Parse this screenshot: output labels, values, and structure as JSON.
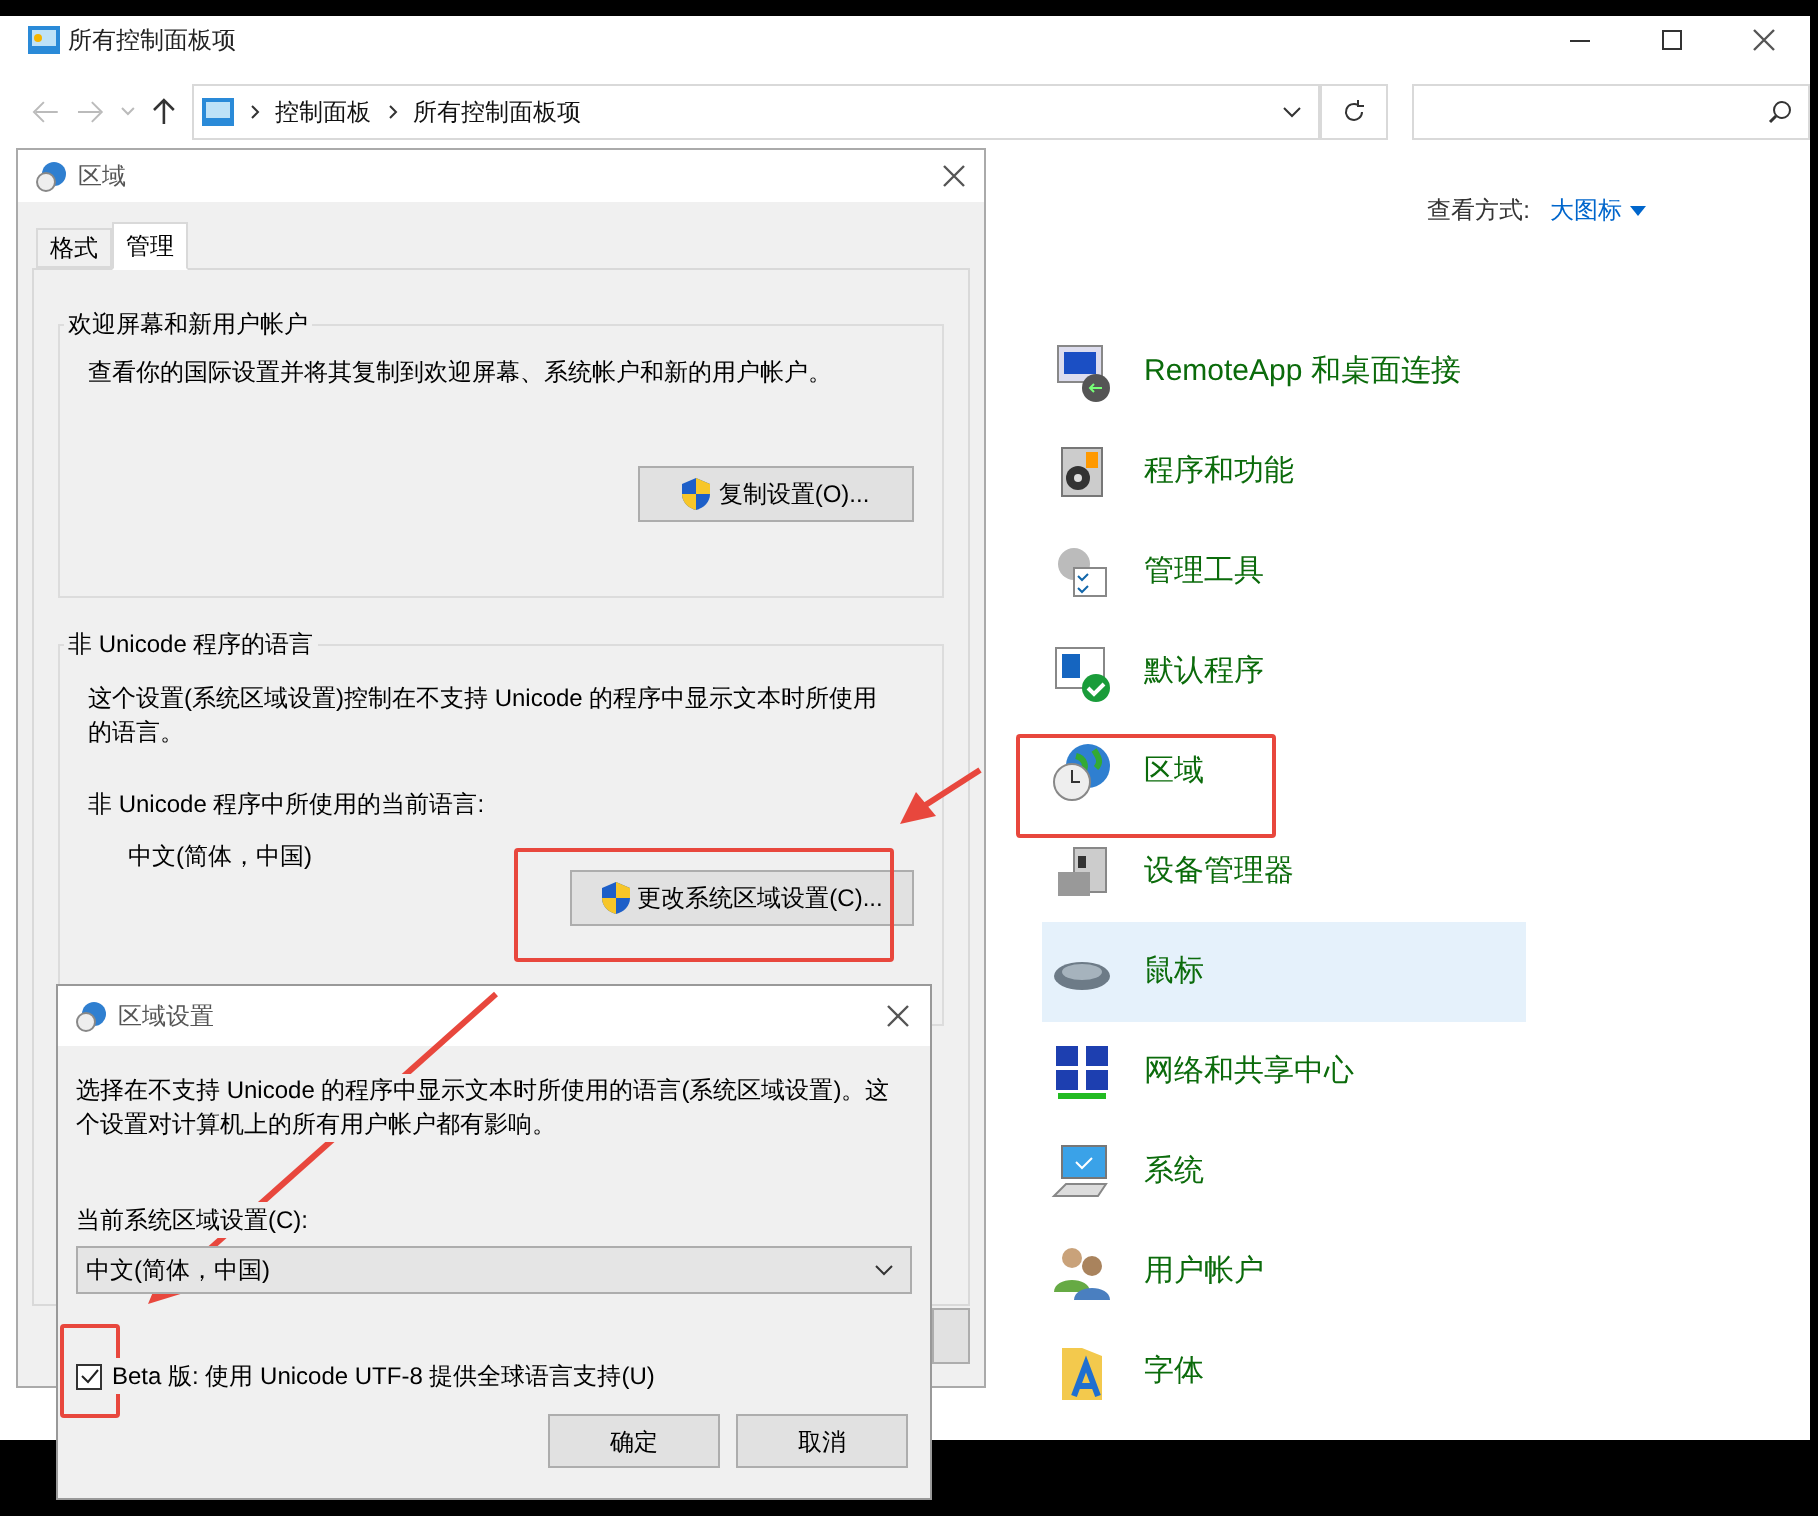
{
  "main_window": {
    "title": "所有控制面板项",
    "breadcrumbs": [
      "控制面板",
      "所有控制面板项"
    ],
    "view_label": "查看方式:",
    "view_value": "大图标",
    "items": [
      {
        "label": "RemoteApp 和桌面连接",
        "hovered": false
      },
      {
        "label": "程序和功能",
        "hovered": false
      },
      {
        "label": "管理工具",
        "hovered": false
      },
      {
        "label": "默认程序",
        "hovered": false
      },
      {
        "label": "区域",
        "hovered": false
      },
      {
        "label": "设备管理器",
        "hovered": false
      },
      {
        "label": "鼠标",
        "hovered": true
      },
      {
        "label": "网络和共享中心",
        "hovered": false
      },
      {
        "label": "系统",
        "hovered": false
      },
      {
        "label": "用户帐户",
        "hovered": false
      },
      {
        "label": "字体",
        "hovered": false
      }
    ]
  },
  "region_dialog": {
    "title": "区域",
    "tabs": [
      {
        "label": "格式",
        "selected": false
      },
      {
        "label": "管理",
        "selected": true
      }
    ],
    "group_1": {
      "title": "欢迎屏幕和新用户帐户",
      "text": "查看你的国际设置并将其复制到欢迎屏幕、系统帐户和新的用户帐户。",
      "button": "复制设置(O)..."
    },
    "group_2": {
      "title": "非 Unicode 程序的语言",
      "text": "这个设置(系统区域设置)控制在不支持 Unicode 的程序中显示文本时所使用的语言。",
      "current_label": "非 Unicode 程序中所使用的当前语言:",
      "current_value": "中文(简体，中国)",
      "button": "更改系统区域设置(C)..."
    }
  },
  "locale_dialog": {
    "title": "区域设置",
    "text": "选择在不支持 Unicode 的程序中显示文本时所使用的语言(系统区域设置)。这个设置对计算机上的所有用户帐户都有影响。",
    "select_label": "当前系统区域设置(C):",
    "select_value": "中文(简体，中国)",
    "checkbox": {
      "label": "Beta 版: 使用 Unicode UTF-8 提供全球语言支持(U)",
      "checked": true
    },
    "buttons": [
      "确定",
      "取消"
    ]
  }
}
